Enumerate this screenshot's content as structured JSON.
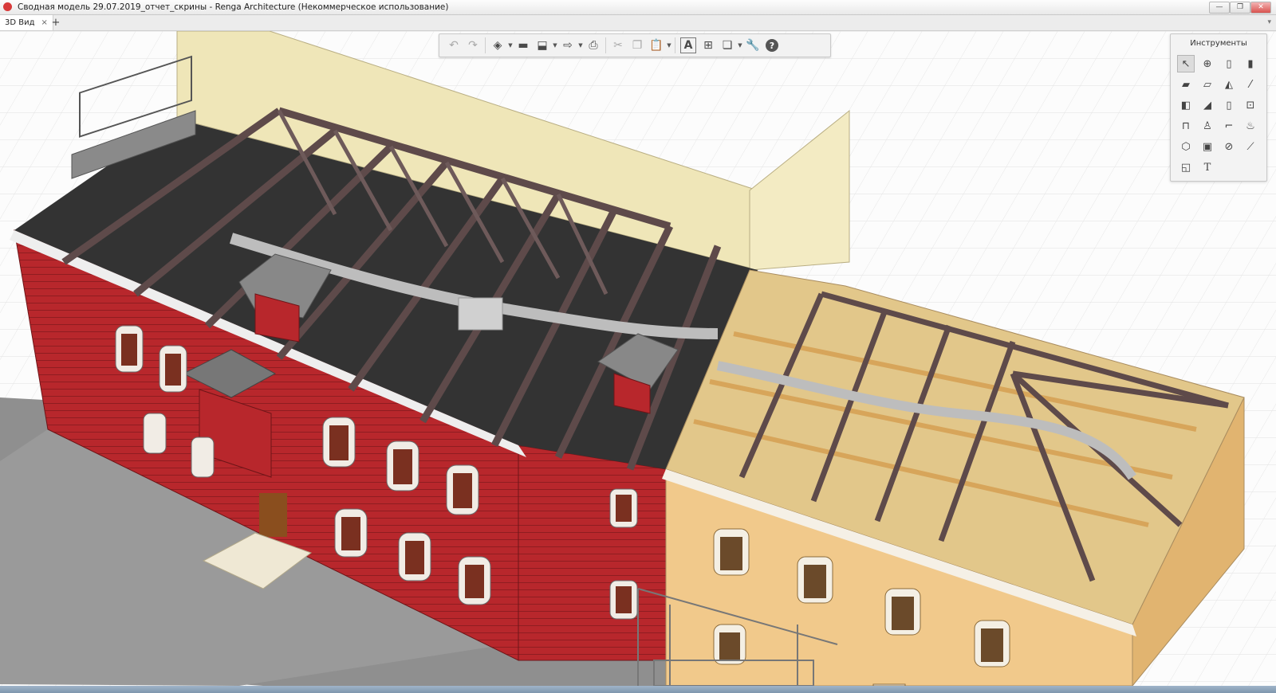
{
  "window": {
    "title": "Сводная модель 29.07.2019_отчет_скрины - Renga Architecture (Некоммерческое использование)",
    "controls": {
      "minimize": "—",
      "maximize": "❐",
      "close": "✕"
    }
  },
  "tabs": {
    "items": [
      {
        "label": "3D Вид",
        "close": "×"
      }
    ],
    "add_label": "+",
    "menu_label": "▾"
  },
  "toolbar": {
    "buttons": [
      {
        "name": "undo-icon",
        "glyph": "↶"
      },
      {
        "name": "redo-icon",
        "glyph": "↷"
      },
      {
        "name": "view-cube-icon",
        "glyph": "◈"
      },
      {
        "name": "open-icon",
        "glyph": "▬"
      },
      {
        "name": "save-icon",
        "glyph": "⬓"
      },
      {
        "name": "export-icon",
        "glyph": "⇨"
      },
      {
        "name": "print-icon",
        "glyph": "⎙"
      },
      {
        "name": "cut-icon",
        "glyph": "✂"
      },
      {
        "name": "copy-icon",
        "glyph": "❐"
      },
      {
        "name": "paste-icon",
        "glyph": "📋"
      },
      {
        "name": "text-style-icon",
        "glyph": "A"
      },
      {
        "name": "tree-icon",
        "glyph": "⊞"
      },
      {
        "name": "layers-icon",
        "glyph": "❏"
      },
      {
        "name": "settings-wrench-icon",
        "glyph": "🔧"
      },
      {
        "name": "help-icon",
        "glyph": "?"
      }
    ]
  },
  "tools_panel": {
    "title": "Инструменты",
    "tools": [
      {
        "name": "select-icon",
        "glyph": "↖"
      },
      {
        "name": "axis-icon",
        "glyph": "⊕"
      },
      {
        "name": "wall-icon",
        "glyph": "▯"
      },
      {
        "name": "column-icon",
        "glyph": "▮"
      },
      {
        "name": "floor-icon",
        "glyph": "▰"
      },
      {
        "name": "slab-opening-icon",
        "glyph": "▱"
      },
      {
        "name": "roof-icon",
        "glyph": "◭"
      },
      {
        "name": "beam-icon",
        "glyph": "⁄"
      },
      {
        "name": "stair-icon",
        "glyph": "◧"
      },
      {
        "name": "ramp-icon",
        "glyph": "◢"
      },
      {
        "name": "door-icon",
        "glyph": "▯"
      },
      {
        "name": "window-icon",
        "glyph": "⊡"
      },
      {
        "name": "railing-icon",
        "glyph": "⊓"
      },
      {
        "name": "plumbing-icon",
        "glyph": "♙"
      },
      {
        "name": "duct-icon",
        "glyph": "⌐"
      },
      {
        "name": "equipment-icon",
        "glyph": "♨"
      },
      {
        "name": "element-icon",
        "glyph": "⬡"
      },
      {
        "name": "room-icon",
        "glyph": "▣"
      },
      {
        "name": "mark-icon",
        "glyph": "⊘"
      },
      {
        "name": "line-icon",
        "glyph": "⟋"
      },
      {
        "name": "hatch-icon",
        "glyph": "◱"
      },
      {
        "name": "text-icon",
        "glyph": "T"
      }
    ]
  },
  "colors": {
    "brick": "#b8272c",
    "brick_dark": "#8f1d21",
    "stucco": "#f1c98b",
    "stucco_shade": "#e1b470",
    "firewall": "#efe6b8",
    "rafters": "#5e4a4a",
    "deck": "#e2c78a",
    "roof_membrane": "#333333",
    "ground": "#8c8c8c"
  }
}
